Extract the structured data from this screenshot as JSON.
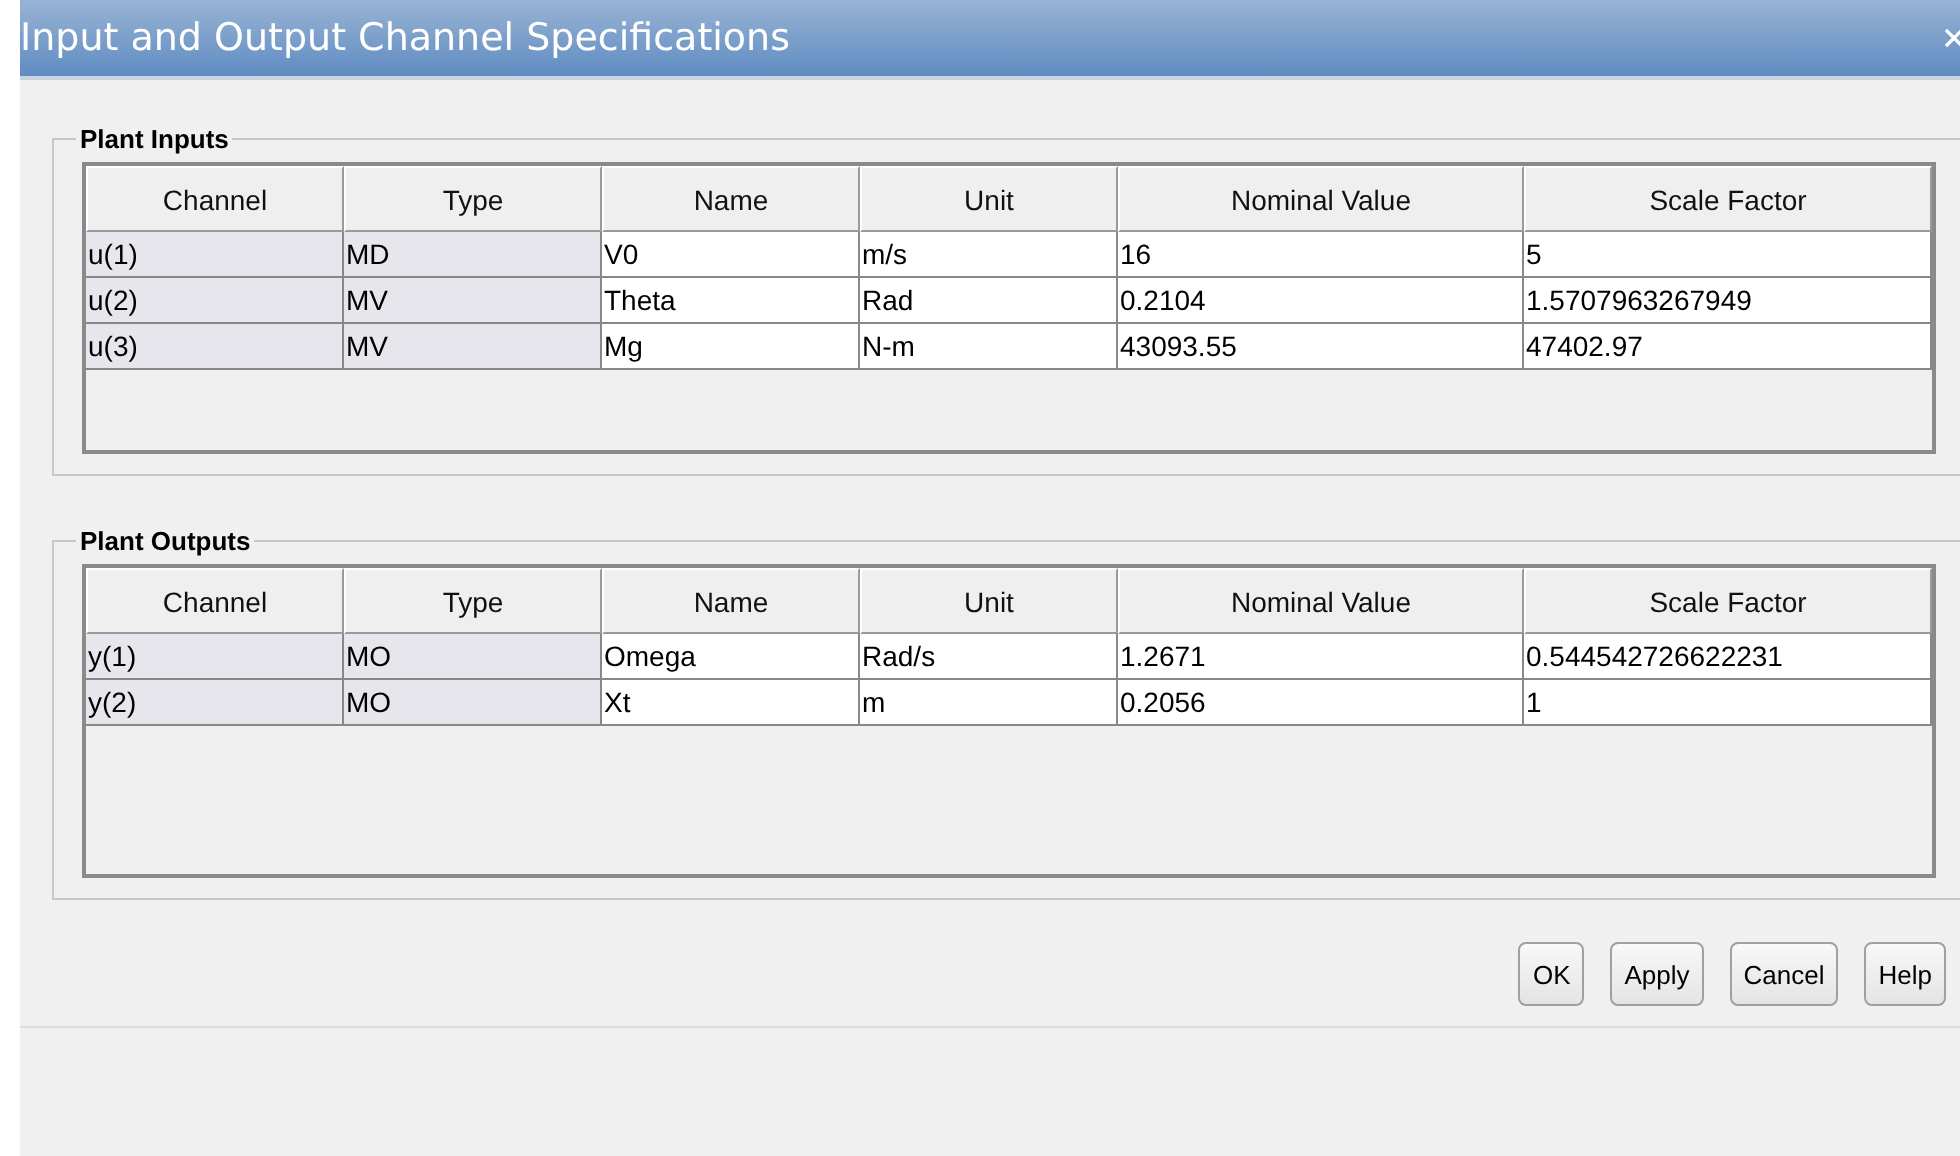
{
  "window": {
    "title": "Input and Output Channel Specifications"
  },
  "groups": [
    {
      "title": "Plant Inputs",
      "columns": [
        {
          "label": "Channel",
          "editable": false
        },
        {
          "label": "Type",
          "editable": false
        },
        {
          "label": "Name",
          "editable": true
        },
        {
          "label": "Unit",
          "editable": true
        },
        {
          "label": "Nominal Value",
          "editable": true
        },
        {
          "label": "Scale Factor",
          "editable": true
        }
      ],
      "rows": [
        [
          "u(1)",
          "MD",
          "V0",
          "m/s",
          "16",
          "5"
        ],
        [
          "u(2)",
          "MV",
          "Theta",
          "Rad",
          "0.2104",
          "1.5707963267949"
        ],
        [
          "u(3)",
          "MV",
          "Mg",
          "N-m",
          "43093.55",
          "47402.97"
        ]
      ]
    },
    {
      "title": "Plant Outputs",
      "columns": [
        {
          "label": "Channel",
          "editable": false
        },
        {
          "label": "Type",
          "editable": false
        },
        {
          "label": "Name",
          "editable": true
        },
        {
          "label": "Unit",
          "editable": true
        },
        {
          "label": "Nominal Value",
          "editable": true
        },
        {
          "label": "Scale Factor",
          "editable": true
        }
      ],
      "rows": [
        [
          "y(1)",
          "MO",
          "Omega",
          "Rad/s",
          "1.2671",
          "0.544542726622231"
        ],
        [
          "y(2)",
          "MO",
          "Xt",
          "m",
          "0.2056",
          "1"
        ]
      ]
    }
  ],
  "buttons": [
    "OK",
    "Apply",
    "Cancel",
    "Help"
  ]
}
